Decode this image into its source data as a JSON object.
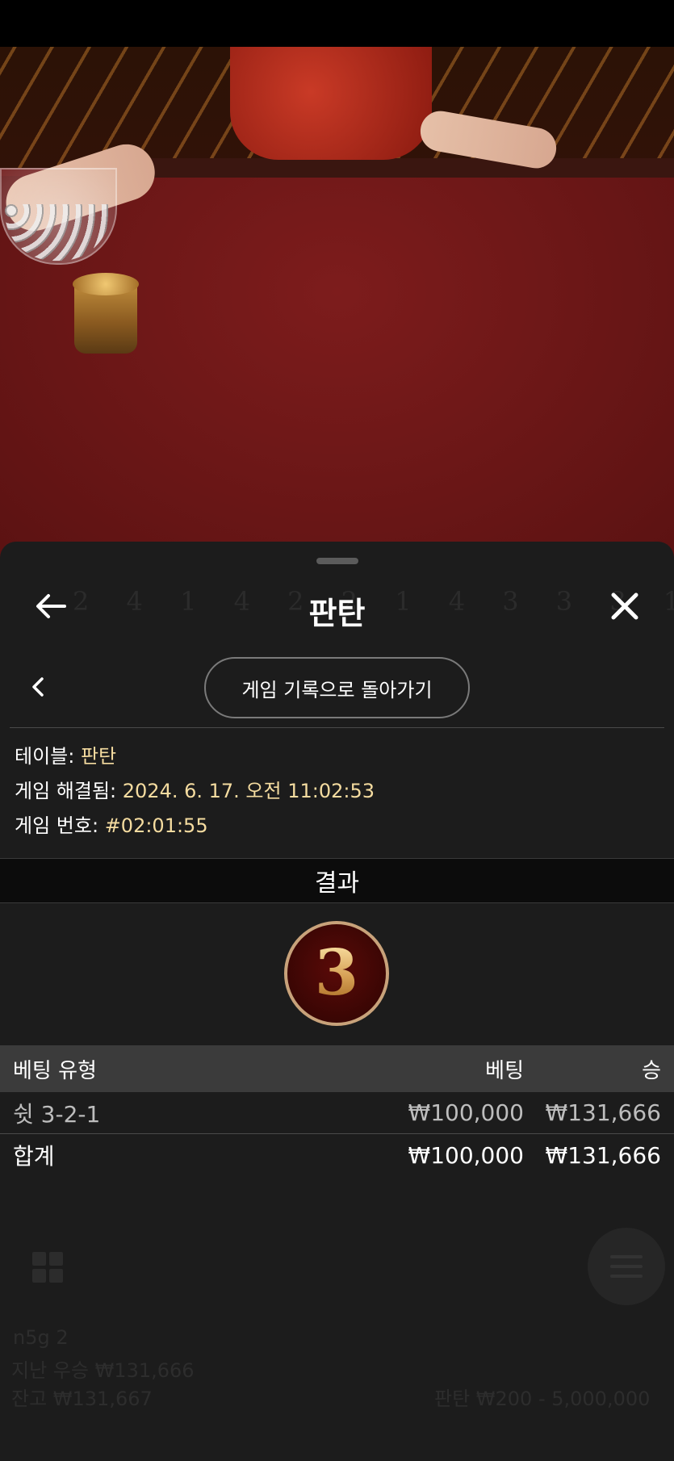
{
  "header": {
    "title": "판탄"
  },
  "navigation": {
    "return_label": "게임 기록으로 돌아가기"
  },
  "info": {
    "table_label": "테이블:",
    "table_value": "판탄",
    "resolved_label": "게임 해결됨:",
    "resolved_value": "2024. 6. 17. 오전 11:02:53",
    "game_no_label": "게임 번호:",
    "game_no_value": "#02:01:55"
  },
  "result": {
    "heading": "결과",
    "number": "3"
  },
  "bets": {
    "columns": {
      "type": "베팅 유형",
      "bet": "베팅",
      "win": "승"
    },
    "rows": [
      {
        "type": "쉿 3-2-1",
        "bet": "₩100,000",
        "win": "₩131,666"
      }
    ],
    "total": {
      "label": "합계",
      "bet": "₩100,000",
      "win": "₩131,666"
    }
  },
  "background_ui": {
    "road_digits": "2 4 1 4 2 2  1 4 3 3 3 1",
    "players": "n5g  2",
    "last_win": "지난 우승 ₩131,666",
    "balance": "잔고 ₩131,667",
    "table_limit": "판탄 ₩200 - 5,000,000"
  },
  "colors": {
    "sheet_bg": "#1c1c1c",
    "value_gold": "#f5dca0",
    "badge_ring": "#c8a27a",
    "badge_fill": "#3a0604"
  }
}
